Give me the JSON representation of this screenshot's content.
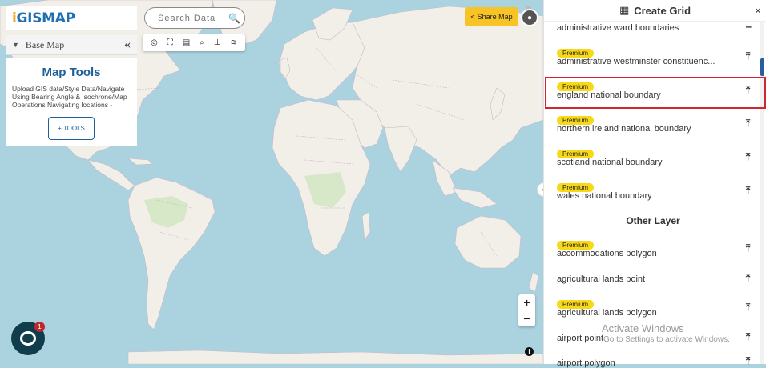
{
  "logo": {
    "text": "GISMAP",
    "prefix": "i"
  },
  "basemap": {
    "label": "Base Map"
  },
  "map_tools": {
    "title": "Map Tools",
    "description": "Upload GIS data/Style Data/Navigate Using Bearing Angle & Isochrone/Map Operations Navigating locations -",
    "button": "+ TOOLS"
  },
  "search": {
    "placeholder": "Search Data"
  },
  "toolbar": {
    "icons": [
      "locate-icon",
      "fullscreen-icon",
      "print-icon",
      "zoom-search-icon",
      "measure-icon",
      "layers-icon"
    ]
  },
  "share": {
    "label": "Share Map"
  },
  "zoom": {
    "in": "+",
    "out": "−"
  },
  "info": {
    "label": "i"
  },
  "chat": {
    "badge": "1"
  },
  "panel": {
    "title": "Create Grid",
    "close": "×",
    "premium_label": "Premium",
    "section": "Other Layer",
    "layers": [
      {
        "name": "administrative ward boundaries",
        "premium": false
      },
      {
        "name": "administrative westminster constituenc...",
        "premium": true
      },
      {
        "name": "england national boundary",
        "premium": true,
        "selected": true
      },
      {
        "name": "northern ireland national boundary",
        "premium": true
      },
      {
        "name": "scotland national boundary",
        "premium": true
      },
      {
        "name": "wales national boundary",
        "premium": true
      }
    ],
    "other_layers": [
      {
        "name": "accommodations polygon",
        "premium": true
      },
      {
        "name": "agricultural lands point",
        "premium": false
      },
      {
        "name": "agricultural lands polygon",
        "premium": true
      },
      {
        "name": "airport point",
        "premium": false
      },
      {
        "name": "airport polygon",
        "premium": false
      }
    ]
  },
  "watermark": {
    "title": "Activate Windows",
    "subtitle": "Go to Settings to activate Windows."
  },
  "colors": {
    "accent": "#1e5f99",
    "premium": "#f7d917",
    "highlight": "#d12631",
    "share": "#f7c325",
    "water": "#aad3df",
    "land": "#f2efe9"
  }
}
